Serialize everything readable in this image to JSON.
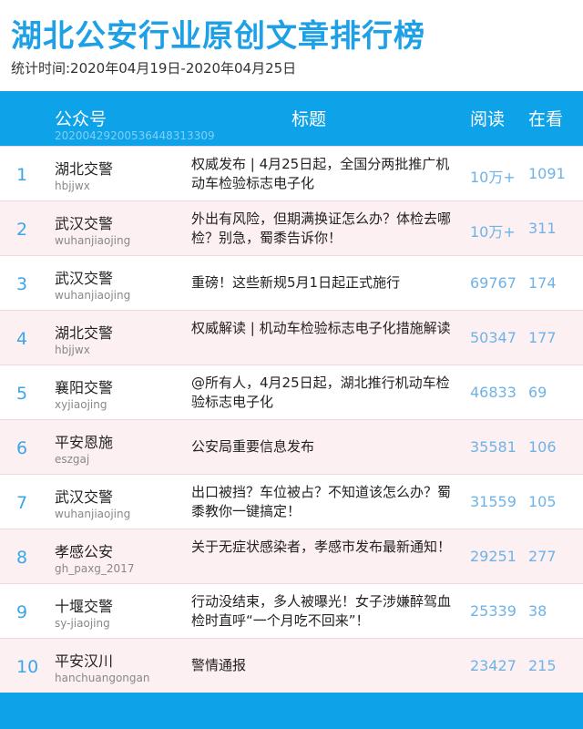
{
  "page": {
    "title": "湖北公安行业原创文章排行榜",
    "subtitle": "统计时间:2020年04月19日-2020年04月25日"
  },
  "header": {
    "account": "公众号",
    "account_id": "20200429200536448313309",
    "title": "标题",
    "reads": "阅读",
    "watching": "在看"
  },
  "colors": {
    "title": "#1ea0e6",
    "header_bg": "#0ea2e8",
    "row_alt_bg": "#fdf0f3",
    "number_text": "#6fb3e6"
  },
  "rows": [
    {
      "rank": "1",
      "name": "湖北交警",
      "id": "hbjjwx",
      "article": "权威发布 | 4月25日起，全国分两批推广机动车检验标志电子化",
      "reads": "10万+",
      "watching": "1091"
    },
    {
      "rank": "2",
      "name": "武汉交警",
      "id": "wuhanjiaojing",
      "article": "外出有风险，但期满换证怎么办？体检去哪检？别急，蜀黍告诉你！",
      "reads": "10万+",
      "watching": "311"
    },
    {
      "rank": "3",
      "name": "武汉交警",
      "id": "wuhanjiaojing",
      "article": "重磅！这些新规5月1日起正式施行",
      "reads": "69767",
      "watching": "174"
    },
    {
      "rank": "4",
      "name": "湖北交警",
      "id": "hbjjwx",
      "article": "权威解读 | 机动车检验标志电子化措施解读",
      "reads": "50347",
      "watching": "177"
    },
    {
      "rank": "5",
      "name": "襄阳交警",
      "id": "xyjiaojing",
      "article": "@所有人，4月25日起，湖北推行机动车检验标志电子化",
      "reads": "46833",
      "watching": "69"
    },
    {
      "rank": "6",
      "name": "平安恩施",
      "id": "eszgaj",
      "article": "公安局重要信息发布",
      "reads": "35581",
      "watching": "106"
    },
    {
      "rank": "7",
      "name": "武汉交警",
      "id": "wuhanjiaojing",
      "article": "出口被挡？车位被占？不知道该怎么办？蜀黍教你一键搞定！",
      "reads": "31559",
      "watching": "105"
    },
    {
      "rank": "8",
      "name": "孝感公安",
      "id": "gh_paxg_2017",
      "article": "关于无症状感染者，孝感市发布最新通知！",
      "reads": "29251",
      "watching": "277"
    },
    {
      "rank": "9",
      "name": "十堰交警",
      "id": "sy-jiaojing",
      "article": "行动没结束，多人被曝光！女子涉嫌醉驾血检时直呼“一个月吃不回来”！",
      "reads": "25339",
      "watching": "38"
    },
    {
      "rank": "10",
      "name": "平安汉川",
      "id": "hanchuangongan",
      "article": "警情通报",
      "reads": "23427",
      "watching": "215"
    }
  ]
}
